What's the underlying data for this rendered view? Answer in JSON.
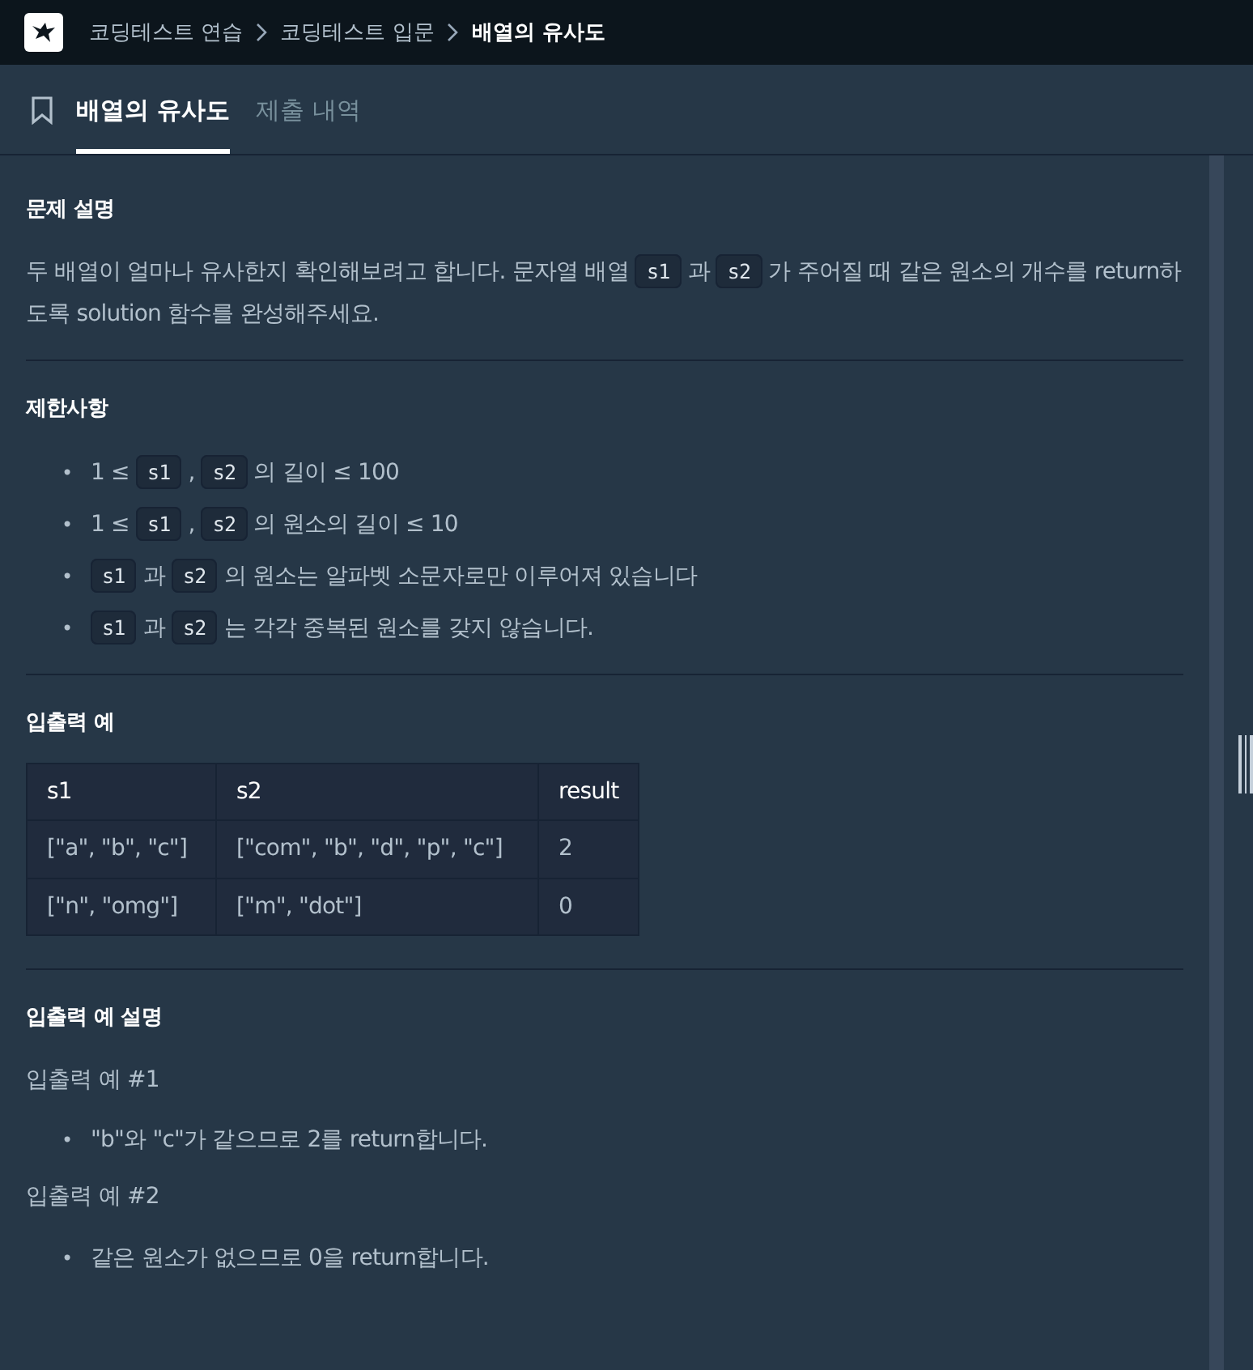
{
  "breadcrumb": [
    {
      "label": "코딩테스트 연습",
      "current": false
    },
    {
      "label": "코딩테스트 입문",
      "current": false
    },
    {
      "label": "배열의 유사도",
      "current": true
    }
  ],
  "tabs": [
    {
      "label": "배열의 유사도",
      "selected": true
    },
    {
      "label": "제출 내역",
      "selected": false
    }
  ],
  "sections": [
    {
      "title": "문제 설명",
      "blocks": [
        {
          "kind": "paragraph",
          "parts": [
            {
              "kind": "text",
              "text": "두 배열이 얼마나 유사한지 확인해보려고 합니다. 문자열 배열 "
            },
            {
              "kind": "code",
              "text": "s1"
            },
            {
              "kind": "text",
              "text": " 과 "
            },
            {
              "kind": "code",
              "text": "s2"
            },
            {
              "kind": "text",
              "text": " 가 주어질 때 같은 원소의 개수를 return하도록 solution 함수를 완성해주세요."
            }
          ]
        }
      ]
    },
    {
      "title": "제한사항",
      "blocks": [
        {
          "kind": "list",
          "marker": "•",
          "items": [
            [
              {
                "kind": "text",
                "text": "1 ≤ "
              },
              {
                "kind": "code",
                "text": "s1"
              },
              {
                "kind": "text",
                "text": " , "
              },
              {
                "kind": "code",
                "text": "s2"
              },
              {
                "kind": "text",
                "text": " 의 길이 ≤ 100"
              }
            ],
            [
              {
                "kind": "text",
                "text": "1 ≤ "
              },
              {
                "kind": "code",
                "text": "s1"
              },
              {
                "kind": "text",
                "text": " , "
              },
              {
                "kind": "code",
                "text": "s2"
              },
              {
                "kind": "text",
                "text": " 의 원소의 길이 ≤ 10"
              }
            ],
            [
              {
                "kind": "code",
                "text": "s1"
              },
              {
                "kind": "text",
                "text": " 과 "
              },
              {
                "kind": "code",
                "text": "s2"
              },
              {
                "kind": "text",
                "text": " 의 원소는 알파벳 소문자로만 이루어져 있습니다"
              }
            ],
            [
              {
                "kind": "code",
                "text": "s1"
              },
              {
                "kind": "text",
                "text": " 과 "
              },
              {
                "kind": "code",
                "text": "s2"
              },
              {
                "kind": "text",
                "text": " 는 각각 중복된 원소를 갖지 않습니다."
              }
            ]
          ]
        }
      ]
    },
    {
      "title": "입출력 예",
      "blocks": [
        {
          "kind": "table",
          "columns": [
            "s1",
            "s2",
            "result"
          ],
          "rows": [
            [
              "[\"a\", \"b\", \"c\"]",
              "[\"com\", \"b\", \"d\", \"p\", \"c\"]",
              "2"
            ],
            [
              "[\"n\", \"omg\"]",
              "[\"m\", \"dot\"]",
              "0"
            ]
          ]
        }
      ]
    },
    {
      "title": "입출력 예 설명",
      "blocks": [
        {
          "kind": "paragraph",
          "parts": [
            {
              "kind": "text",
              "text": "입출력 예 #1"
            }
          ]
        },
        {
          "kind": "list",
          "marker": "•",
          "items": [
            [
              {
                "kind": "text",
                "text": "\"b\"와 \"c\"가 같으므로 2를 return합니다."
              }
            ]
          ]
        },
        {
          "kind": "paragraph",
          "parts": [
            {
              "kind": "text",
              "text": "입출력 예 #2"
            }
          ]
        },
        {
          "kind": "list",
          "marker": "•",
          "items": [
            [
              {
                "kind": "text",
                "text": "같은 원소가 없으므로 0을 return합니다."
              }
            ]
          ]
        }
      ]
    }
  ]
}
